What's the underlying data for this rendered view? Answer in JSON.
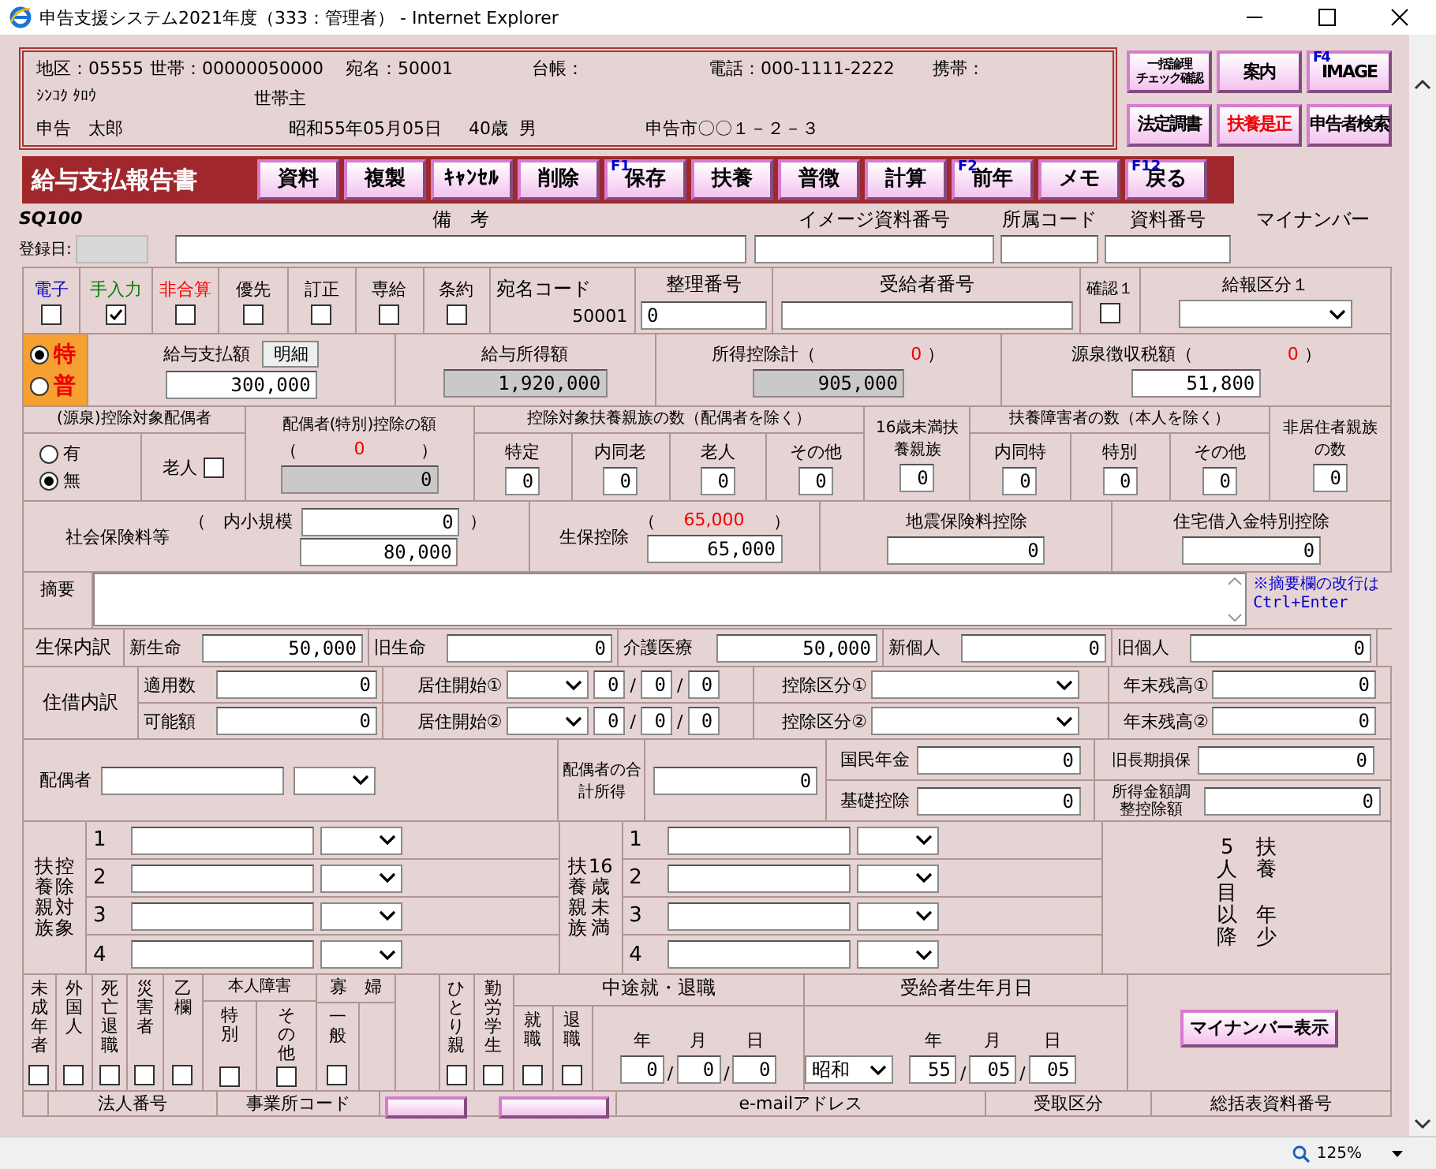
{
  "window": {
    "title": "申告支援システム2021年度（333：管理者） - Internet Explorer"
  },
  "header": {
    "line1": [
      "地区：05555",
      "世帯：00000050000",
      "宛名：50001",
      "台帳：",
      "電話：000-1111-2222",
      "携帯："
    ],
    "kana": "ｼﾝｺｸ ﾀﾛｳ",
    "relation": "世帯主",
    "name": "申告　太郎",
    "birth": "昭和55年05月05日",
    "age": "40歳",
    "sex": "男",
    "address": "申告市〇〇１－２－３"
  },
  "side_buttons": [
    {
      "lines": [
        "一括論理",
        "チェック確認"
      ],
      "alert": false
    },
    {
      "lines": [
        "案内"
      ],
      "alert": false
    },
    {
      "fkey": "F4",
      "lines": [
        "IMAGE"
      ],
      "alert": false
    },
    {
      "lines": [
        "法定調書"
      ],
      "alert": false
    },
    {
      "lines": [
        "扶養是正"
      ],
      "alert": true
    },
    {
      "lines": [
        "申告者検索"
      ],
      "alert": false
    }
  ],
  "form": {
    "title": "給与支払報告書",
    "code": "SQ100"
  },
  "toolbar": [
    {
      "label": "資料"
    },
    {
      "label": "複製"
    },
    {
      "label": "ｷｬﾝｾﾙ"
    },
    {
      "label": "削除"
    },
    {
      "fkey": "F1",
      "label": "保存"
    },
    {
      "label": "扶養"
    },
    {
      "label": "普徴"
    },
    {
      "label": "計算"
    },
    {
      "fkey": "F2",
      "label": "前年"
    },
    {
      "label": "メモ"
    },
    {
      "fkey": "F12",
      "label": "戻る"
    }
  ],
  "remarks_row": {
    "reg_date_label": "登録日:",
    "remarks_label": "備　考",
    "image_no_label": "イメージ資料番号",
    "dept_label": "所属コード",
    "doc_no_label": "資料番号",
    "mynumber_label": "マイナンバー"
  },
  "flags": [
    {
      "label": "電子",
      "color": "#0000cc",
      "checked": false
    },
    {
      "label": "手入力",
      "color": "#008000",
      "checked": true
    },
    {
      "label": "非合算",
      "color": "#ff0000",
      "checked": false
    },
    {
      "label": "優先",
      "color": "#000000",
      "checked": false
    },
    {
      "label": "訂正",
      "color": "#000000",
      "checked": false
    },
    {
      "label": "専給",
      "color": "#000000",
      "checked": false
    },
    {
      "label": "条約",
      "color": "#000000",
      "checked": false
    }
  ],
  "ids": {
    "atena_label": "宛名コード",
    "atena_value": "50001",
    "seiri_label": "整理番号",
    "seiri_value": "0",
    "jukyu_label": "受給者番号",
    "confirm_label": "確認１",
    "confirm_checked": false,
    "kubun_label": "給報区分１"
  },
  "collection": [
    {
      "label": "特",
      "selected": true
    },
    {
      "label": "普",
      "selected": false
    }
  ],
  "amounts": {
    "pay_label": "給与支払額",
    "detail_button": "明細",
    "pay": "300,000",
    "income_label": "給与所得額",
    "income": "1,920,000",
    "deduction_label": "所得控除計（",
    "deduction_paren": "0",
    "deduction_close": "）",
    "deduction": "905,000",
    "tax_label": "源泉徴収税額（",
    "tax_paren": "0",
    "tax_close": "）",
    "tax": "51,800"
  },
  "spouse": {
    "title": "(源泉)控除対象配偶者",
    "options": [
      {
        "label": "有",
        "selected": false
      },
      {
        "label": "無",
        "selected": true
      }
    ],
    "elderly_label": "老人",
    "elderly_checked": false,
    "amount_title": "配偶者(特別)控除の額",
    "amount_open": "（",
    "amount_paren": "0",
    "amount_close": "）",
    "amount": "0"
  },
  "dependents": {
    "title": "控除対象扶養親族の数（配偶者を除く）",
    "items": [
      {
        "label": "特定",
        "value": "0"
      },
      {
        "label": "内同老",
        "value": "0"
      },
      {
        "label": "老人",
        "value": "0"
      },
      {
        "label": "その他",
        "value": "0"
      }
    ]
  },
  "under16": {
    "title": "16歳未満扶養親族",
    "value": "0"
  },
  "disabled_dependents": {
    "title": "扶養障害者の数（本人を除く）",
    "items": [
      {
        "label": "内同特",
        "value": "0"
      },
      {
        "label": "特別",
        "value": "0"
      },
      {
        "label": "その他",
        "value": "0"
      }
    ]
  },
  "nonresident": {
    "title": "非居住者親族の数",
    "value": "0"
  },
  "insurance": {
    "social_label": "社会保険料等",
    "small_label": "（　内小規模",
    "small": "0",
    "small_close": "）",
    "social": "80,000",
    "life_label": "生保控除",
    "life_open": "（",
    "life_paren": "65,000",
    "life_close": "）",
    "life": "65,000",
    "quake_label": "地震保険料控除",
    "quake": "0",
    "housing_label": "住宅借入金特別控除",
    "housing": "0"
  },
  "memo": {
    "label": "摘要",
    "note": "※摘要欄の改行は Ctrl+Enter"
  },
  "life_detail": {
    "label": "生保内訳",
    "items": [
      {
        "label": "新生命",
        "value": "50,000"
      },
      {
        "label": "旧生命",
        "value": "0"
      },
      {
        "label": "介護医療",
        "value": "50,000"
      },
      {
        "label": "新個人",
        "value": "0"
      },
      {
        "label": "旧個人",
        "value": "0"
      }
    ]
  },
  "housing_detail": {
    "label": "住借内訳",
    "rows": [
      {
        "count_label": "適用数",
        "count": "0",
        "start_label": "居住開始①",
        "date": [
          "0",
          "0",
          "0"
        ],
        "seps": [
          "/",
          "/"
        ],
        "kubun_label": "控除区分①",
        "balance_label": "年末残高①",
        "balance": "0"
      },
      {
        "count_label": "可能額",
        "count": "0",
        "start_label": "居住開始②",
        "date": [
          "0",
          "0",
          "0"
        ],
        "seps": [
          "/",
          "/"
        ],
        "kubun_label": "控除区分②",
        "balance_label": "年末残高②",
        "balance": "0"
      }
    ]
  },
  "spouse_info": {
    "label": "配偶者",
    "income_label": "配偶者の合計所得",
    "income": "0",
    "pension_label": "国民年金",
    "pension": "0",
    "basic_label": "基礎控除",
    "basic": "0",
    "old_ins_label": "旧長期損保",
    "old_ins": "0",
    "adjust_label": "所得金額調整控除額",
    "adjust": "0"
  },
  "dependent_list": {
    "label_cols": [
      "扶養親族",
      "控除対象"
    ],
    "rows": [
      "1",
      "2",
      "3",
      "4"
    ]
  },
  "young_list": {
    "label_cols": [
      "扶養親族",
      "16歳未満"
    ],
    "rows": [
      "1",
      "2",
      "3",
      "4"
    ]
  },
  "fifth": {
    "label_cols": [
      [
        "5人目以降"
      ],
      [
        "扶養",
        "年少"
      ]
    ]
  },
  "status_flags": [
    {
      "label": "未成年者",
      "checked": false
    },
    {
      "label": "外国人",
      "checked": false
    },
    {
      "label": "死亡退職",
      "checked": false
    },
    {
      "label": "災害者",
      "checked": false
    },
    {
      "label": "乙欄",
      "checked": false
    }
  ],
  "disability": {
    "label": "本人障害",
    "items": [
      {
        "label": "特別",
        "checked": false
      },
      {
        "label": "その他",
        "checked": false
      }
    ]
  },
  "widow": {
    "label": "寡　婦",
    "items": [
      {
        "label": "一般",
        "checked": false
      }
    ]
  },
  "single_parent": [
    {
      "label": "ひとり親",
      "checked": false
    },
    {
      "label": "勤労学生",
      "checked": false
    }
  ],
  "job_change": {
    "label": "中途就・退職",
    "items": [
      {
        "label": "就職",
        "checked": false
      },
      {
        "label": "退職",
        "checked": false
      }
    ],
    "date_labels": [
      "年",
      "月",
      "日"
    ],
    "date": [
      "0",
      "0",
      "0"
    ],
    "seps": [
      "/",
      "/"
    ]
  },
  "birth": {
    "label": "受給者生年月日",
    "era": "昭和",
    "date_labels": [
      "年",
      "月",
      "日"
    ],
    "date": [
      "55",
      "05",
      "05"
    ],
    "seps": [
      "/",
      "/"
    ]
  },
  "mynumber_button": "マイナンバー表示",
  "bottom_headers": [
    "法人番号",
    "事業所コード",
    "e-mailアドレス",
    "受取区分",
    "総括表資料番号"
  ],
  "status_bar": {
    "zoom": "125%"
  }
}
